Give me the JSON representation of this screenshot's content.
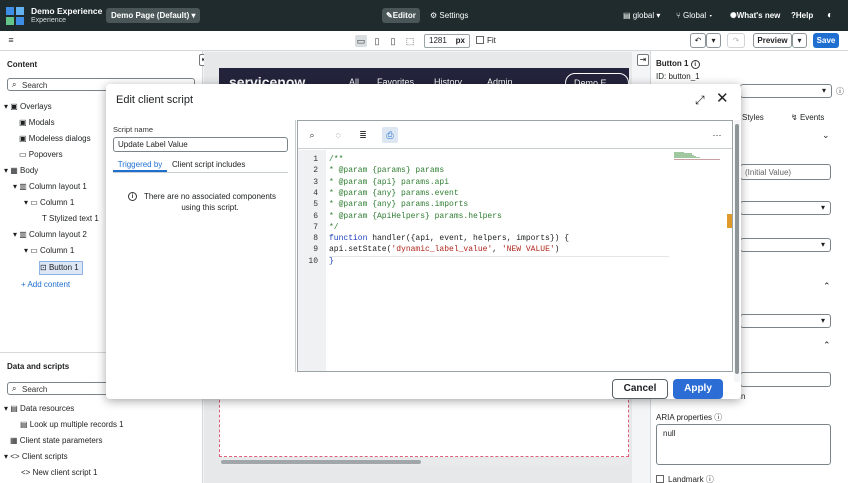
{
  "topbar": {
    "app_title": "Demo Experience",
    "app_subtitle": "Experience",
    "page_selector": "Demo Page (Default)",
    "editor_label": "Editor",
    "settings_label": "Settings",
    "scope_label": "global",
    "global_label": "Global",
    "whats_new_label": "What's new",
    "help_label": "Help"
  },
  "toolbar": {
    "resolution": "1281",
    "unit": "px",
    "fit_label": "Fit",
    "preview_label": "Preview",
    "save_label": "Save"
  },
  "content_panel": {
    "title": "Content",
    "search_placeholder": "Search",
    "tree": [
      {
        "label": "Overlays",
        "level": 0
      },
      {
        "label": "Modals",
        "level": 1
      },
      {
        "label": "Modeless dialogs",
        "level": 1
      },
      {
        "label": "Popovers",
        "level": 1
      },
      {
        "label": "Body",
        "level": 0
      },
      {
        "label": "Column layout 1",
        "level": 1
      },
      {
        "label": "Column 1",
        "level": 2
      },
      {
        "label": "Stylized text 1",
        "level": 3
      },
      {
        "label": "Column layout 2",
        "level": 1
      },
      {
        "label": "Column 1",
        "level": 2
      },
      {
        "label": "Button 1",
        "level": 3
      }
    ],
    "add_content_label": "Add content"
  },
  "data_panel": {
    "title": "Data and scripts",
    "search_placeholder": "Search",
    "tree": [
      {
        "label": "Data resources",
        "level": 0
      },
      {
        "label": "Look up multiple records 1",
        "level": 1
      },
      {
        "label": "Client state parameters",
        "level": 0
      },
      {
        "label": "Client scripts",
        "level": 0
      },
      {
        "label": "New client script 1",
        "level": 1
      }
    ]
  },
  "canvas": {
    "header_logo": "servicenow",
    "header_nav": [
      "All",
      "Favorites",
      "History",
      "Admin"
    ],
    "header_button": "Demo E"
  },
  "config_panel": {
    "title": "Button 1",
    "id_text": "ID: button_1",
    "tab_styles": "Styles",
    "tab_events": "Events",
    "initial_value_placeholder": "(Initial Value)",
    "on_text": "n",
    "aria_label": "ARIA properties",
    "aria_value": "null",
    "landmark_label": "Landmark"
  },
  "modal": {
    "title": "Edit client script",
    "script_name_label": "Script name",
    "script_name_value": "Update Label Value",
    "tab_triggered_by": "Triggered by",
    "tab_includes": "Client script includes",
    "empty_message": "There are no associated components using this script.",
    "cancel_label": "Cancel",
    "apply_label": "Apply",
    "line_numbers": [
      "1",
      "2",
      "3",
      "4",
      "5",
      "6",
      "7",
      "8",
      "9",
      "10"
    ],
    "code": {
      "l1": "/**",
      "l2": "* @param {params} params",
      "l3": "* @param {api} params.api",
      "l4": "* @param {any} params.event",
      "l5": "* @param {any} params.imports",
      "l6": "* @param {ApiHelpers} params.helpers",
      "l7": "*/",
      "l8_kw": "function",
      "l8_rest": " handler({api, event, helpers, imports}) {",
      "l9_start": "api.setState(",
      "l9_str1": "'dynamic_label_value'",
      "l9_mid": ", ",
      "l9_str2": "'NEW VALUE'",
      "l9_end": ")",
      "l10": "}"
    }
  }
}
